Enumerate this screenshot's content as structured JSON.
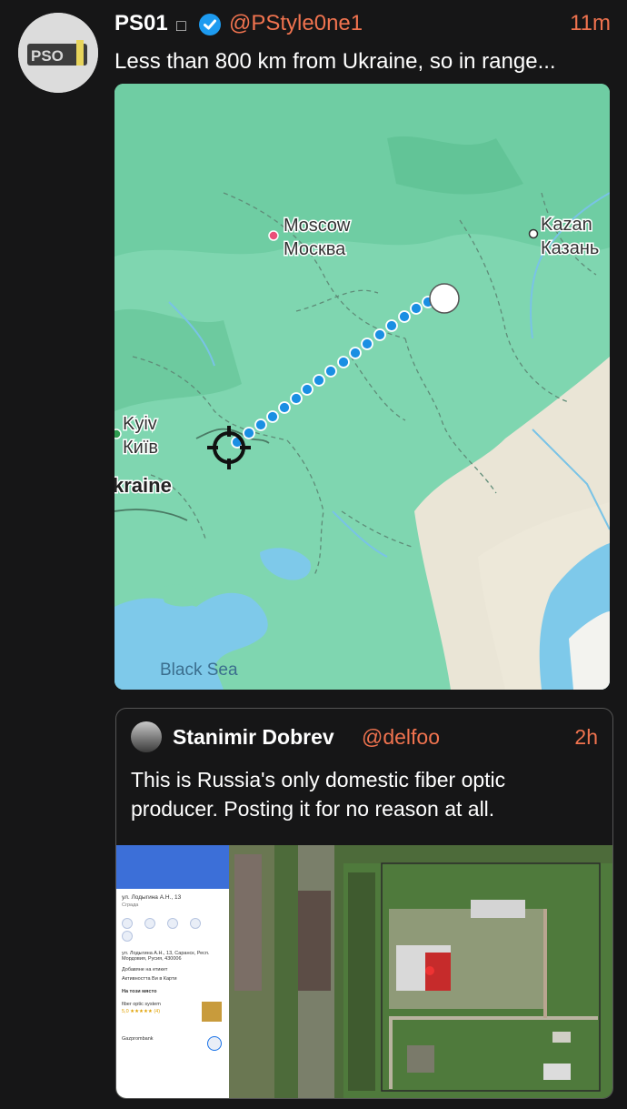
{
  "tweet": {
    "author_name": "PS01",
    "badge_square": "□",
    "verified_icon": "verified-check-icon",
    "handle": "@PStyle0ne1",
    "time": "11m",
    "text": "Less than 800 km from Ukraine, so in range...",
    "avatar_text": "PSO",
    "map": {
      "labels": {
        "moscow_en": "Moscow",
        "moscow_ru": "Москва",
        "kazan_en": "Kazan",
        "kazan_ru": "Казань",
        "kyiv_en": "Kyiv",
        "kyiv_ua": "Київ",
        "ukraine": "kraine",
        "black_sea": "Black Sea"
      },
      "colors": {
        "land": "#7fd6b0",
        "water": "#7ec9ea",
        "route": "#1a8fe3",
        "moscow_marker": "#ea4f79",
        "desert": "#eae5d6"
      }
    }
  },
  "quote": {
    "author_name": "Stanimir Dobrev",
    "handle": "@delfoo",
    "time": "2h",
    "text": "This is Russia's only domestic fiber optic producer. Posting it for no reason at all.",
    "image_panel": {
      "address": "ул. Лодыгина А.Н., 13",
      "category": "Сграда",
      "address_full": "ул. Лодыгина А.Н., 13, Саранск, Респ. Мордовия, Русия, 430006",
      "add_label": "Добавяне на етикет",
      "activity_label": "Активността Ви в Карти",
      "nearby": "На този място",
      "place1": "fiber optic system",
      "rating": "5,0 ★★★★★ (4)",
      "place2": "Gazprombank"
    }
  }
}
